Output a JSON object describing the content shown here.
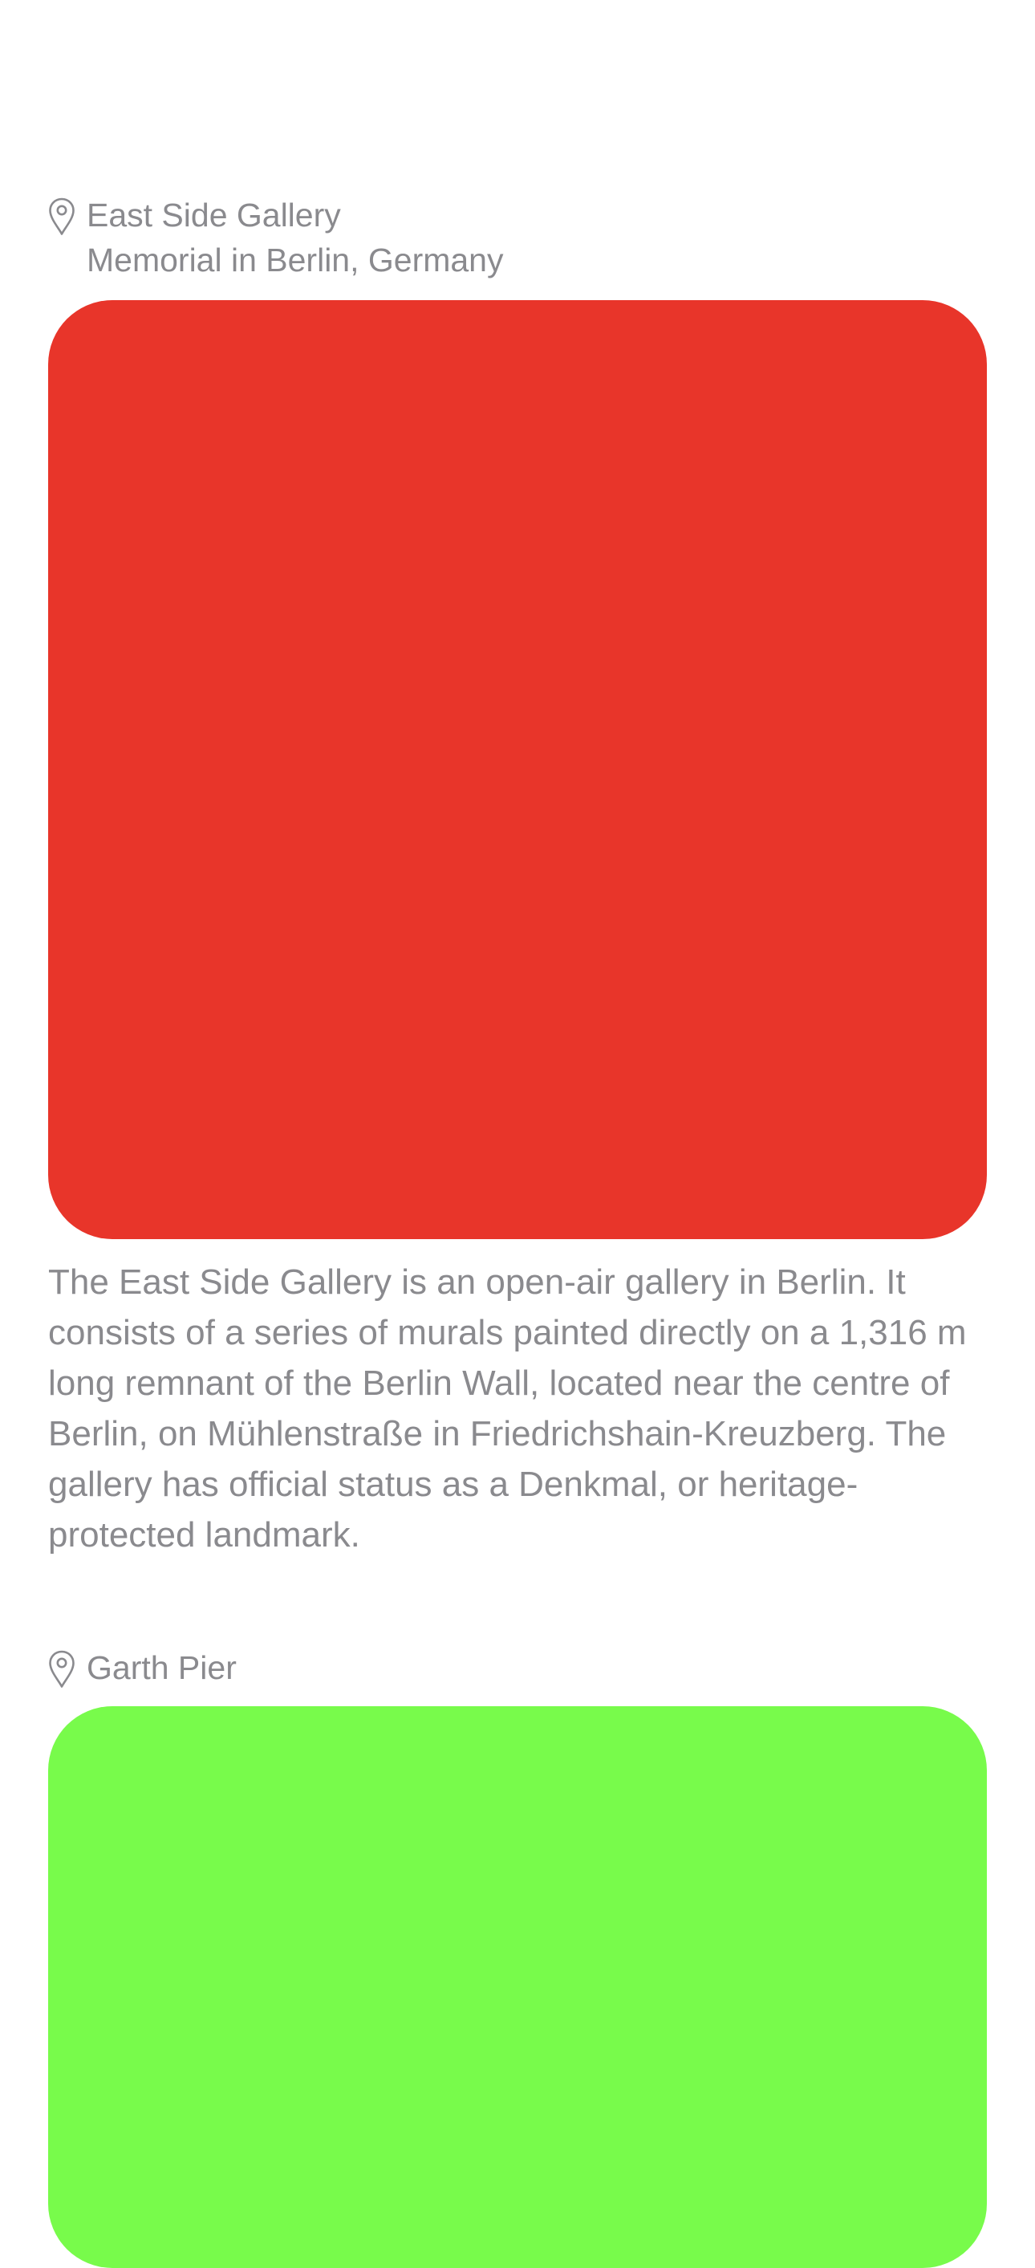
{
  "places": [
    {
      "title": "East Side Gallery",
      "subtitle": "Memorial in Berlin, Germany",
      "image_color": "#e8352a",
      "description": "The East Side Gallery is an open-air gallery in Berlin. It consists of a series of murals painted directly on a 1,316 m long remnant of the Berlin Wall, located near the centre of Berlin, on Mühlenstraße in Friedrichshain-Kreuzberg. The gallery has official status as a Denkmal, or heritage-protected landmark.",
      "icon": "map-pin-icon"
    },
    {
      "title": "Garth Pier",
      "image_color": "#78fb4b",
      "icon": "map-pin-icon"
    }
  ]
}
